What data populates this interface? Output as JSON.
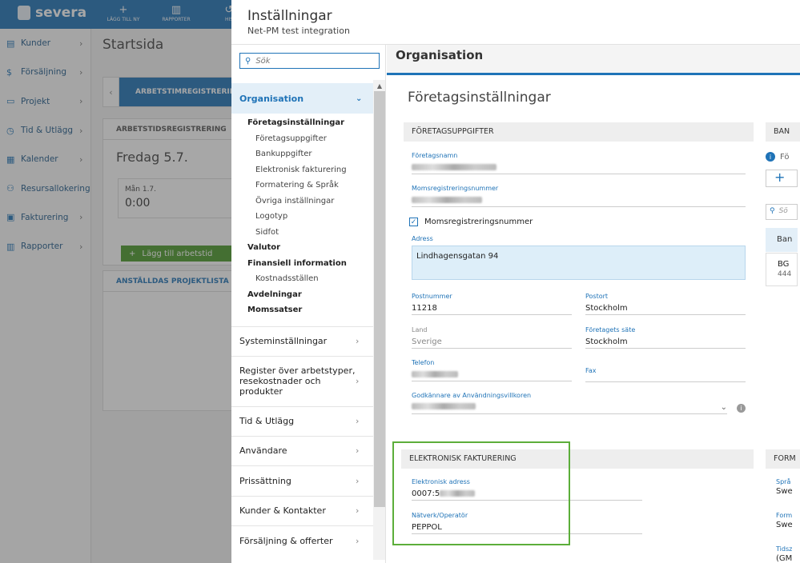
{
  "app": {
    "brand": "severa",
    "top_actions": [
      {
        "label": "LÄGG TILL NY",
        "icon": "plus-icon"
      },
      {
        "label": "RAPPORTER",
        "icon": "bar-chart-icon"
      },
      {
        "label": "HIS",
        "icon": "history-icon"
      }
    ],
    "sidebar": [
      {
        "label": "Kunder",
        "icon": "customers-icon"
      },
      {
        "label": "Försäljning",
        "icon": "dollar-icon"
      },
      {
        "label": "Projekt",
        "icon": "folder-icon"
      },
      {
        "label": "Tid & Utlägg",
        "icon": "clock-icon"
      },
      {
        "label": "Kalender",
        "icon": "calendar-icon"
      },
      {
        "label": "Resursallokering",
        "icon": "resources-icon"
      },
      {
        "label": "Fakturering",
        "icon": "invoice-icon"
      },
      {
        "label": "Rapporter",
        "icon": "bar-chart-icon"
      }
    ],
    "page_title": "Startsida",
    "tab_active": "ARBETSTIMREGISTRERING",
    "reg_header": "ARBETSTIDSREGISTRERING",
    "day_title": "Fredag 5.7.",
    "day_box_label": "Mån 1.7.",
    "day_box_value": "0:00",
    "add_button": "Lägg till arbetstid",
    "project_list_header": "ANSTÄLLDAS PROJEKTLISTA"
  },
  "settings": {
    "title": "Inställningar",
    "subtitle": "Net-PM test integration",
    "search_placeholder": "Sök",
    "nav_active": "Organisation",
    "sub_items": [
      {
        "label": "Företagsinställningar",
        "level": 1
      },
      {
        "label": "Företagsuppgifter",
        "level": 2
      },
      {
        "label": "Bankuppgifter",
        "level": 2
      },
      {
        "label": "Elektronisk fakturering",
        "level": 2
      },
      {
        "label": "Formatering & Språk",
        "level": 2
      },
      {
        "label": "Övriga inställningar",
        "level": 2
      },
      {
        "label": "Logotyp",
        "level": 2
      },
      {
        "label": "Sidfot",
        "level": 2
      },
      {
        "label": "Valutor",
        "level": 1
      },
      {
        "label": "Finansiell information",
        "level": 1
      },
      {
        "label": "Kostnadsställen",
        "level": 2
      },
      {
        "label": "Avdelningar",
        "level": 1
      },
      {
        "label": "Momssatser",
        "level": 1
      }
    ],
    "nav_items": [
      {
        "label": "Systeminställningar",
        "height": 37
      },
      {
        "label": "Register över arbetstyper, resekostnader och produkter",
        "height": 63
      },
      {
        "label": "Tid & Utlägg",
        "height": 37
      },
      {
        "label": "Användare",
        "height": 37
      },
      {
        "label": "Prissättning",
        "height": 38
      },
      {
        "label": "Kunder & Kontakter",
        "height": 37
      },
      {
        "label": "Försäljning & offerter",
        "height": 38
      }
    ],
    "content_header": "Organisation",
    "section_title": "Företagsinställningar",
    "company_box": {
      "header": "FÖRETAGSUPPGIFTER",
      "company_name_label": "Företagsnamn",
      "vat_label": "Momsregistreringsnummer",
      "vat_checkbox_label": "Momsregistreringsnummer",
      "address_label": "Adress",
      "address_value": "Lindhagensgatan 94",
      "postal_label": "Postnummer",
      "postal_value": "11218",
      "city_label": "Postort",
      "city_value": "Stockholm",
      "country_label": "Land",
      "country_value": "Sverige",
      "seat_label": "Företagets säte",
      "seat_value": "Stockholm",
      "phone_label": "Telefon",
      "fax_label": "Fax",
      "approver_label": "Godkännare av Användningsvillkoren"
    },
    "einvoice_box": {
      "header": "ELEKTRONISK FAKTURERING",
      "address_label": "Elektronisk adress",
      "address_value": "0007:5",
      "operator_label": "Nätverk/Operatör",
      "operator_value": "PEPPOL"
    },
    "right_column": {
      "bank_header": "BAN",
      "info_text": "Fö",
      "search_text": "Sö",
      "table_header": "Ban",
      "row_title": "BG",
      "row_sub": "444",
      "format_header": "FORM",
      "lang_label": "Språ",
      "lang_value": "Swe",
      "format_label": "Form",
      "format_value": "Swe",
      "tz_label": "Tidsz",
      "tz_value": "(GM"
    }
  }
}
